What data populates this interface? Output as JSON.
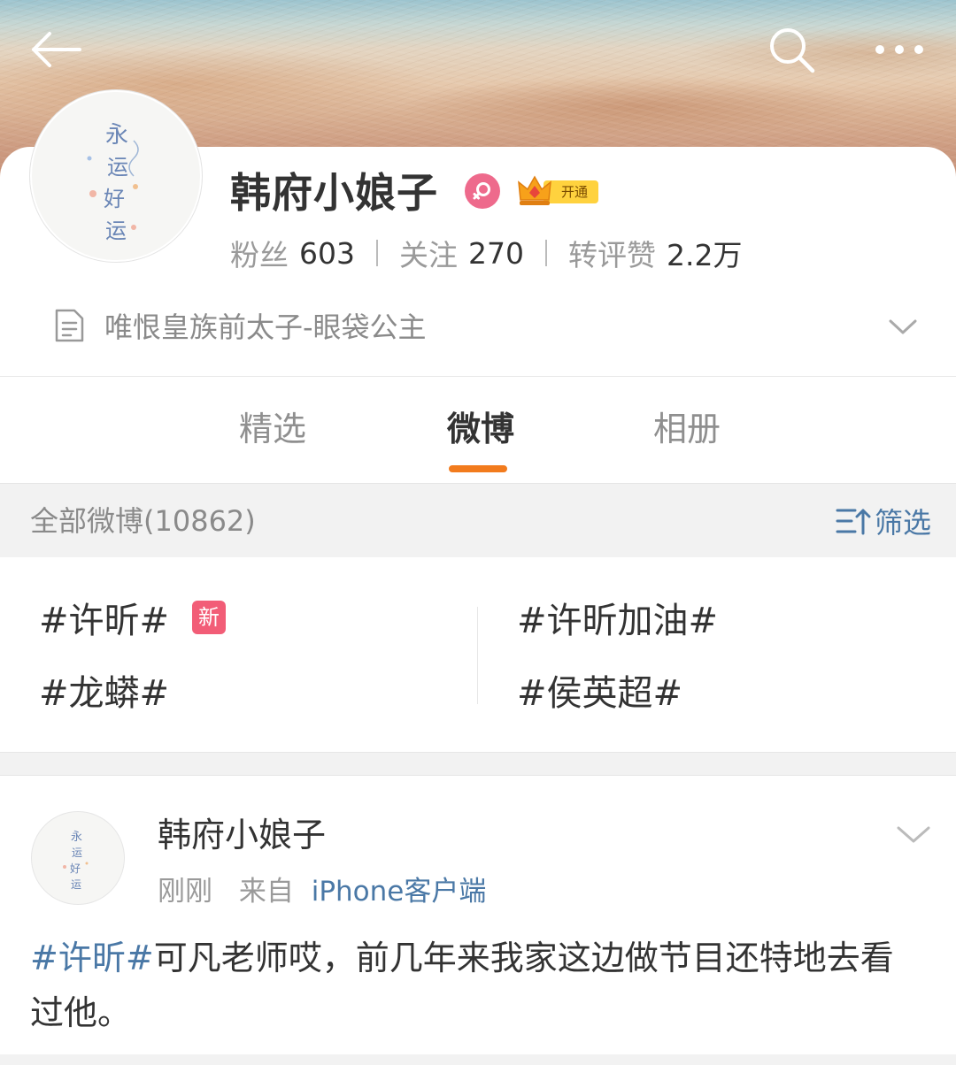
{
  "header": {
    "icons": {
      "back": "back-arrow-icon",
      "search": "search-icon",
      "more": "more-dots-icon"
    }
  },
  "profile": {
    "username": "韩府小娘子",
    "avatar_text": "永运好运",
    "vip_label": "开通",
    "stats": {
      "fans_label": "粉丝",
      "fans_value": "603",
      "following_label": "关注",
      "following_value": "270",
      "interactions_label": "转评赞",
      "interactions_value": "2.2万"
    },
    "bio": "唯恨皇族前太子-眼袋公主"
  },
  "tabs": {
    "featured": "精选",
    "weibo": "微博",
    "album": "相册",
    "active": "weibo"
  },
  "filter_bar": {
    "all_posts": "全部微博(10862)",
    "filter_label": "筛选"
  },
  "topics": {
    "items": [
      "#许昕#",
      "#许昕加油#",
      "#龙蟒#",
      "#侯英超#"
    ],
    "new_badge": "新"
  },
  "post": {
    "author": "韩府小娘子",
    "time": "刚刚",
    "from_prefix": "来自",
    "source": "iPhone客户端",
    "hashtag": "#许昕#",
    "text": "可凡老师哎，前几年来我家这边做节目还特地去看过他。"
  },
  "colors": {
    "accent_orange": "#f27b1d",
    "link_blue": "#4a78a6",
    "female_pink": "#ee6a8c",
    "new_badge_red": "#f25d77"
  }
}
